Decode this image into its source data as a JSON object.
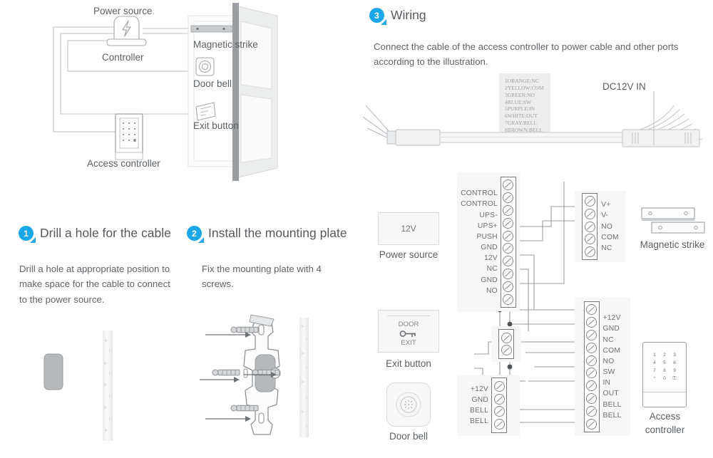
{
  "steps": [
    {
      "number": "1",
      "title": "Drill a hole for the cable",
      "body": "Drill a hole at appropriate position to make space for the cable to connect to the power source."
    },
    {
      "number": "2",
      "title": "Install the mounting plate",
      "body": "Fix the mounting plate with 4 screws."
    },
    {
      "number": "3",
      "title": "Wiring",
      "body": "Connect the cable of the access controller to power cable and other ports according to the illustration."
    }
  ],
  "overview": {
    "power_source": "Power source",
    "controller": "Controller",
    "magnetic_strike": "Magnetic strike",
    "door_bell": "Door bell",
    "exit_button": "Exit button",
    "access_controller": "Access controller"
  },
  "wiring": {
    "dc_in_label": "DC12V IN",
    "wire_legend": [
      "1ORANGE:NC",
      "2YELLOW:COM",
      "3GREEN:NO",
      "4BLUE:SW",
      "5PURPLE:IN",
      "6WHITE:OUT",
      "7GRAY:BELL",
      "8BROWN:BELL"
    ],
    "blocks": {
      "controller_main": {
        "pins": [
          "CONTROL",
          "CONTROL",
          "UPS-",
          "UPS+",
          "PUSH",
          "GND",
          "12V",
          "NC",
          "GND",
          "NO"
        ]
      },
      "strike": {
        "pins": [
          "V+",
          "V-",
          "NO",
          "COM",
          "NC"
        ]
      },
      "access": {
        "pins": [
          "+12V",
          "GND",
          "NC",
          "COM",
          "NO",
          "SW",
          "IN",
          "OUT",
          "BELL",
          "BELL"
        ]
      },
      "bell": {
        "pins": [
          "+12V",
          "GND",
          "BELL",
          "BELL"
        ]
      },
      "exit": {
        "pins": [
          "",
          ""
        ]
      }
    },
    "devices": {
      "power_source": {
        "label": "Power source",
        "face": "12V"
      },
      "exit_button": {
        "label": "Exit button",
        "face_top": "DOOR",
        "face_bottom": "EXIT"
      },
      "door_bell": {
        "label": "Door bell"
      },
      "magnetic_strike": {
        "label": "Magnetic strike"
      },
      "access_controller": {
        "label_line1": "Access",
        "label_line2": "controller"
      }
    },
    "keypad": [
      "1",
      "2",
      "3",
      "4",
      "5",
      "6",
      "7",
      "8",
      "9",
      "*",
      "0",
      "⚿"
    ]
  },
  "colors": {
    "accent": "#1aa7e8",
    "line": "#9a9ea2",
    "text": "#5a5f63"
  }
}
